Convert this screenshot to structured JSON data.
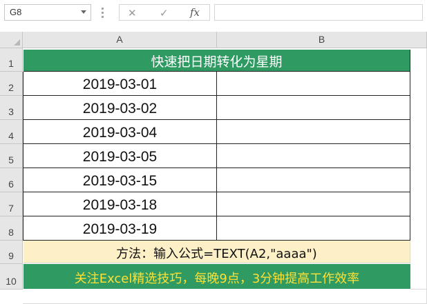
{
  "formula_bar": {
    "name_box": "G8",
    "cancel_glyph": "✕",
    "enter_glyph": "✓",
    "fx_label": "fx",
    "formula": ""
  },
  "columns": [
    "A",
    "B"
  ],
  "rows": [
    "1",
    "2",
    "3",
    "4",
    "5",
    "6",
    "7",
    "8",
    "9",
    "10"
  ],
  "sheet": {
    "title": "快速把日期转化为星期",
    "dates": [
      "2019-03-01",
      "2019-03-02",
      "2019-03-04",
      "2019-03-05",
      "2019-03-15",
      "2019-03-18",
      "2019-03-19"
    ],
    "method": "方法：输入公式=TEXT(A2,\"aaaa\")",
    "tip": "关注Excel精选技巧，每晚9点，3分钟提高工作效率"
  },
  "colors": {
    "header_green": "#2f9a62",
    "method_bg": "#fdf0c7",
    "tip_text": "#ffe033",
    "title_text": "#ffffff"
  },
  "icons": {
    "name_box_dropdown": "chevron-down-icon",
    "cancel": "close-icon",
    "enter": "check-icon",
    "insert_function": "fx-icon",
    "select_all": "select-all-triangle-icon"
  }
}
